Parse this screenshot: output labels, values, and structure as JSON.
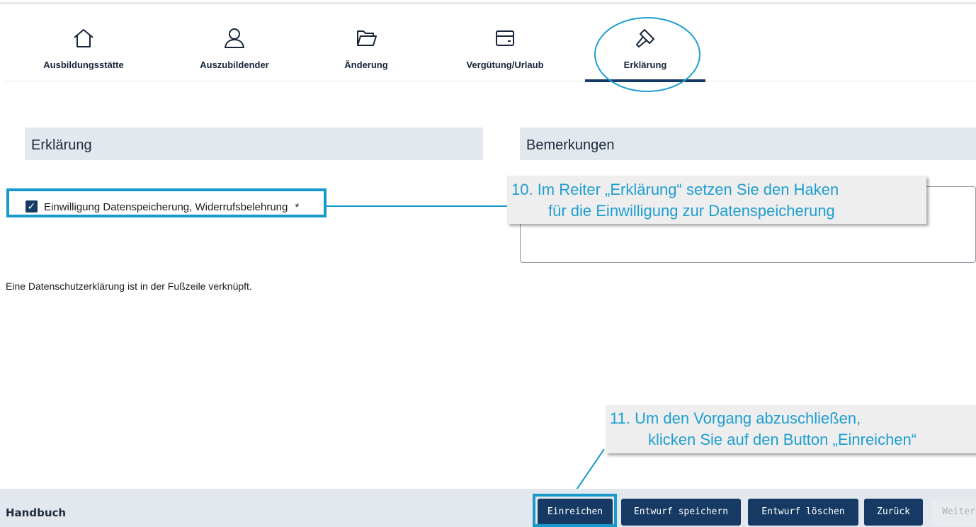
{
  "tabs": [
    {
      "label": "Ausbildungsstätte",
      "icon": "home-icon"
    },
    {
      "label": "Auszubildender",
      "icon": "person-icon"
    },
    {
      "label": "Änderung",
      "icon": "folder-icon"
    },
    {
      "label": "Vergütung/Urlaub",
      "icon": "card-icon"
    },
    {
      "label": "Erklärung",
      "icon": "hammer-icon",
      "active": true
    }
  ],
  "sections": {
    "declaration_title": "Erklärung",
    "remarks_title": "Bemerkungen"
  },
  "consent": {
    "label": "Einwilligung Datenspeicherung, Widerrufsbelehrung",
    "required_mark": "*",
    "checked": true
  },
  "privacy_note": "Eine Datenschutzerklärung ist in der Fußzeile verknüpft.",
  "callouts": {
    "step10_line1": "10. Im Reiter „Erklärung“ setzen Sie den Haken",
    "step10_line2": "für die Einwilligung zur Datenspeicherung",
    "step11_line1": "11. Um den Vorgang abzuschließen,",
    "step11_line2": "klicken Sie auf den Button „Einreichen“"
  },
  "footer": {
    "manual_label": "Handbuch",
    "buttons": {
      "submit": "Einreichen",
      "save_draft": "Entwurf speichern",
      "delete_draft": "Entwurf löschen",
      "back": "Zurück",
      "next": "Weiter"
    }
  },
  "colors": {
    "primary": "#163a64",
    "highlight": "#1899cc",
    "callout_text": "#1f9ed0",
    "section_bg": "#e3e8ee"
  }
}
